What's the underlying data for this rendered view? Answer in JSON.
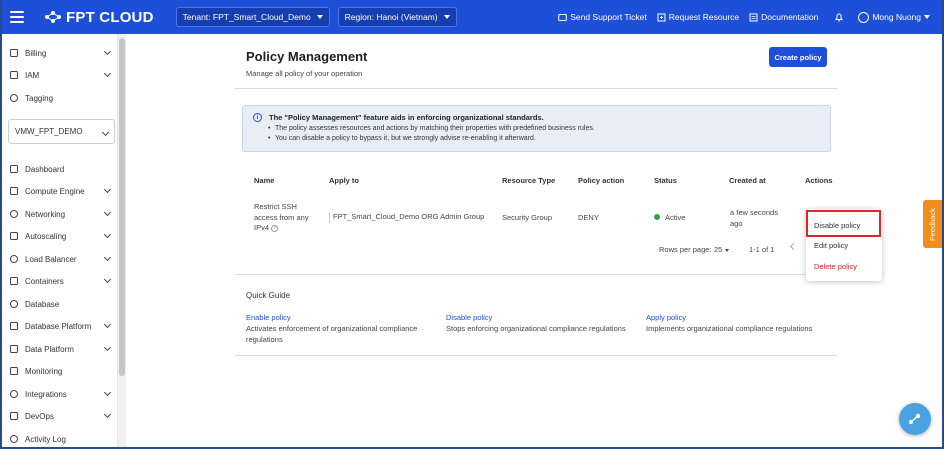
{
  "topbar": {
    "brand": "FPT CLOUD",
    "tenant": "Tenant: FPT_Smart_Cloud_Demo",
    "region": "Region: Hanoi (Vietnam)",
    "links": {
      "support": "Send Support Ticket",
      "request": "Request Resource",
      "docs": "Documentation"
    },
    "user": "Mong Nuong"
  },
  "sidebar": {
    "items_top": [
      {
        "label": "Billing",
        "icon": "billing-icon"
      },
      {
        "label": "IAM",
        "icon": "iam-icon"
      },
      {
        "label": "Tagging",
        "icon": "tag-icon"
      }
    ],
    "project": "VMW_FPT_DEMO",
    "items": [
      {
        "label": "Dashboard",
        "icon": "dashboard-icon"
      },
      {
        "label": "Compute Engine",
        "icon": "compute-icon"
      },
      {
        "label": "Networking",
        "icon": "network-icon"
      },
      {
        "label": "Autoscaling",
        "icon": "autoscaling-icon"
      },
      {
        "label": "Load Balancer",
        "icon": "load-balancer-icon"
      },
      {
        "label": "Containers",
        "icon": "container-icon"
      },
      {
        "label": "Database",
        "icon": "database-icon"
      },
      {
        "label": "Database Platform",
        "icon": "database-platform-icon"
      },
      {
        "label": "Data Platform",
        "icon": "data-platform-icon"
      },
      {
        "label": "Monitoring",
        "icon": "monitoring-icon"
      },
      {
        "label": "Integrations",
        "icon": "integrations-icon"
      },
      {
        "label": "DevOps",
        "icon": "devops-icon"
      },
      {
        "label": "Activity Log",
        "icon": "activity-log-icon"
      }
    ]
  },
  "page": {
    "title": "Policy Management",
    "subtitle": "Manage all policy of your operation",
    "create_button": "Create policy"
  },
  "info": {
    "title": "The \"Policy Management\" feature aids in enforcing organizational standards.",
    "lines": [
      "The policy assesses resources and actions by matching their properties with predefined business rules.",
      "You can disable a policy to bypass it, but we strongly advise re-enabling it afterward."
    ]
  },
  "table": {
    "headers": [
      "Name",
      "Apply to",
      "Resource Type",
      "Policy action",
      "Status",
      "Created at",
      "Actions"
    ],
    "rows": [
      {
        "name_lines": [
          "Restrict SSH",
          "access from any",
          "IPv4"
        ],
        "apply_to": "FPT_Smart_Cloud_Demo ORG Admin Group",
        "resource_type": "Security Group",
        "policy_action": "DENY",
        "status": "Active",
        "created_lines": [
          "a few seconds",
          "ago"
        ]
      }
    ],
    "pagination": {
      "rows_per_page_label": "Rows per page:",
      "rows_per_page": "25",
      "range": "1-1 of 1"
    }
  },
  "actions_menu": {
    "disable": "Disable policy",
    "edit": "Edit policy",
    "delete": "Delete policy"
  },
  "quick_guide": {
    "title": "Quick Guide",
    "items": [
      {
        "link": "Enable policy",
        "desc_lines": [
          "Activates enforcement of organizational compliance",
          "regulations"
        ]
      },
      {
        "link": "Disable policy",
        "desc_lines": [
          "Stops enforcing organizational compliance regulations"
        ]
      },
      {
        "link": "Apply policy",
        "desc_lines": [
          "Implements organizational compliance regulations"
        ]
      }
    ]
  },
  "feedback": "Feedback",
  "colors": {
    "brand_blue": "#1e4fd8",
    "status_active": "#27a844",
    "delete_red": "#d9262c",
    "feedback_orange": "#f28c1b"
  }
}
